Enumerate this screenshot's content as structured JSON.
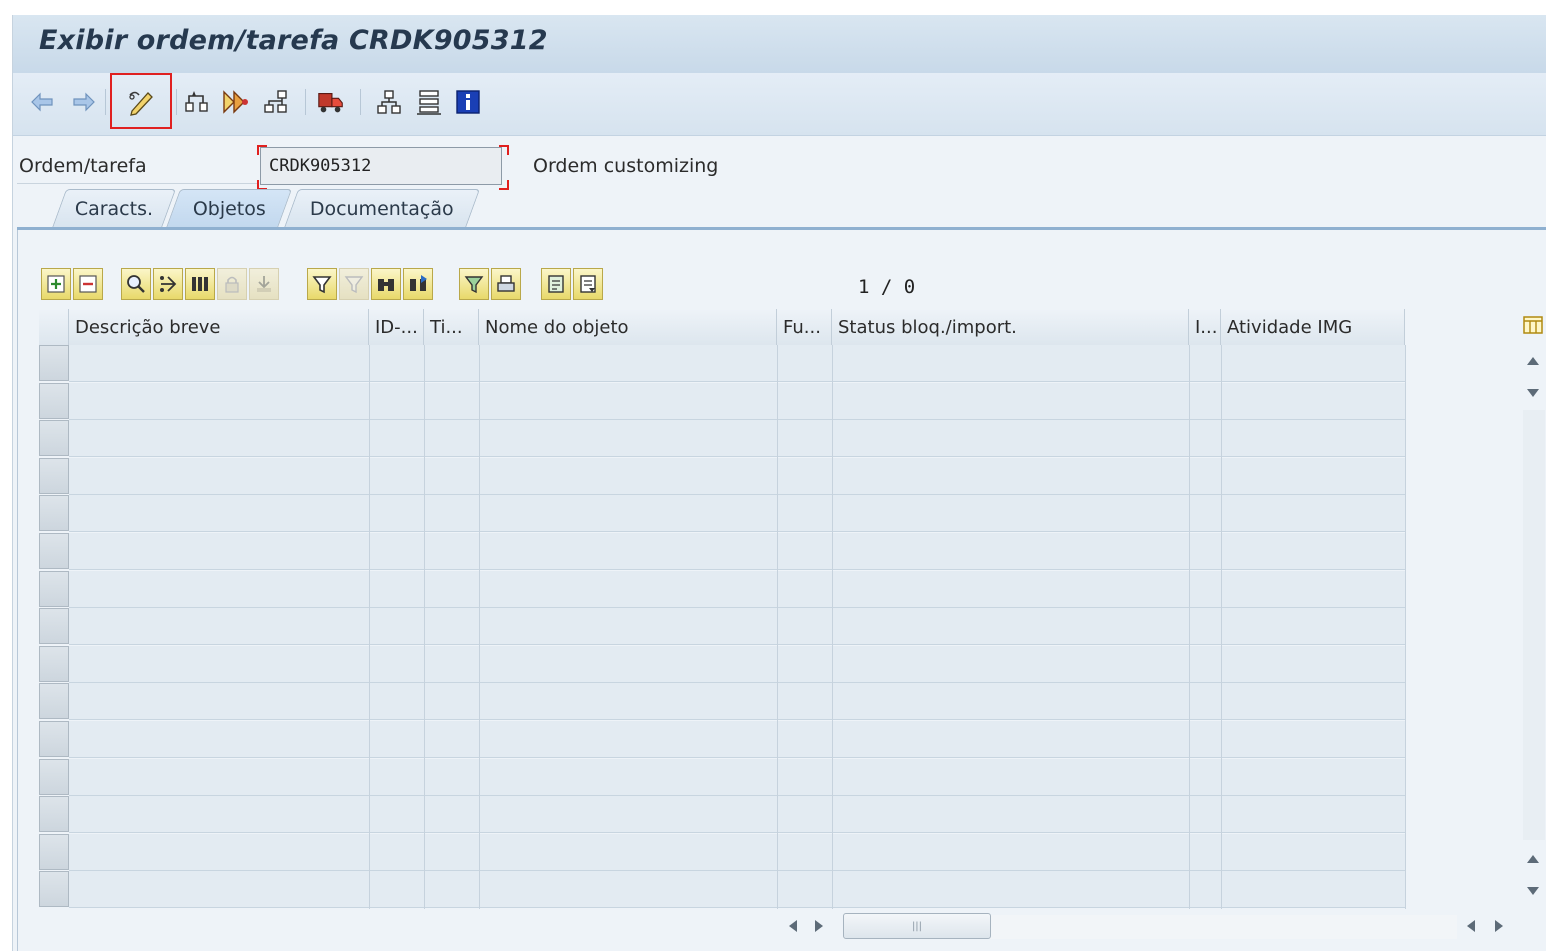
{
  "window": {
    "title": "Exibir ordem/tarefa CRDK905312"
  },
  "toolbar": {
    "buttons": [
      {
        "name": "back",
        "icon": "arrow-left-icon"
      },
      {
        "name": "forward",
        "icon": "arrow-right-icon"
      },
      {
        "name": "display-change",
        "icon": "pencil-glasses-icon",
        "highlighted": true
      },
      {
        "name": "other-object",
        "icon": "object-tree-icon"
      },
      {
        "name": "release",
        "icon": "release-arrows-icon"
      },
      {
        "name": "hierarchy",
        "icon": "hierarchy-icon"
      },
      {
        "name": "transport",
        "icon": "truck-icon"
      },
      {
        "name": "structure",
        "icon": "org-structure-icon"
      },
      {
        "name": "list",
        "icon": "stacked-list-icon"
      },
      {
        "name": "info",
        "icon": "info-icon"
      }
    ],
    "highlight_color": "#e02020"
  },
  "header": {
    "field_label": "Ordem/tarefa",
    "field_value": "CRDK905312",
    "field_description": "Ordem customizing"
  },
  "tabs": [
    {
      "label": "Caracts.",
      "active": false
    },
    {
      "label": "Objetos",
      "active": true
    },
    {
      "label": "Documentação",
      "active": false
    }
  ],
  "alv_toolbar": {
    "counter": "1 / 0"
  },
  "grid": {
    "columns": [
      "Descrição breve",
      "ID-...",
      "Ti...",
      "Nome do objeto",
      "Fu...",
      "Status bloq./import.",
      "I...",
      "Atividade IMG"
    ],
    "empty_rows": 15
  },
  "colors": {
    "accent": "#8fb0d0",
    "title_text": "#26394f",
    "row_bg": "#e3ebf2"
  }
}
